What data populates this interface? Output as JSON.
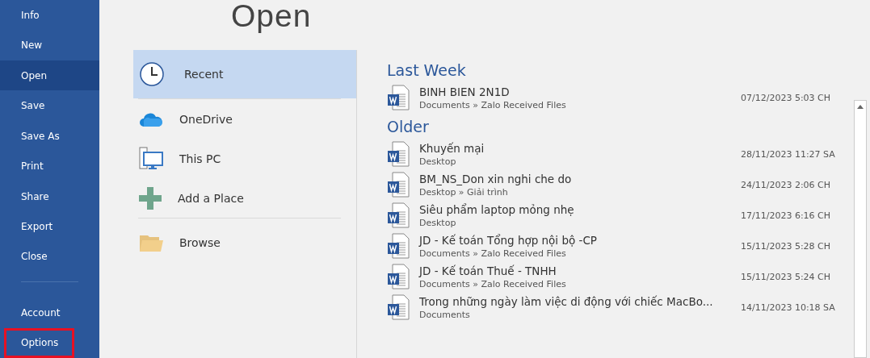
{
  "nav": {
    "items": [
      {
        "label": "Info",
        "selected": false,
        "highlighted": false
      },
      {
        "label": "New",
        "selected": false,
        "highlighted": false
      },
      {
        "label": "Open",
        "selected": true,
        "highlighted": false
      },
      {
        "label": "Save",
        "selected": false,
        "highlighted": false
      },
      {
        "label": "Save As",
        "selected": false,
        "highlighted": false
      },
      {
        "label": "Print",
        "selected": false,
        "highlighted": false
      },
      {
        "label": "Share",
        "selected": false,
        "highlighted": false
      },
      {
        "label": "Export",
        "selected": false,
        "highlighted": false
      },
      {
        "label": "Close",
        "selected": false,
        "highlighted": false
      }
    ],
    "bottom_items": [
      {
        "label": "Account",
        "selected": false,
        "highlighted": false
      },
      {
        "label": "Options",
        "selected": false,
        "highlighted": true
      }
    ]
  },
  "title": "Open",
  "places": [
    {
      "label": "Recent",
      "kind": "recent",
      "selected": true
    },
    {
      "label": "OneDrive",
      "kind": "cloud",
      "selected": false
    },
    {
      "label": "This PC",
      "kind": "pc",
      "selected": false
    },
    {
      "label": "Add a Place",
      "kind": "add",
      "selected": false
    },
    {
      "label": "Browse",
      "kind": "folder",
      "selected": false
    }
  ],
  "groups": [
    {
      "heading": "Last Week",
      "files": [
        {
          "name": "BINH BIEN 2N1D",
          "path": "Documents » Zalo Received Files",
          "date": "07/12/2023 5:03 CH"
        }
      ]
    },
    {
      "heading": "Older",
      "files": [
        {
          "name": "Khuyến mại",
          "path": "Desktop",
          "date": "28/11/2023 11:27 SA"
        },
        {
          "name": "BM_NS_Don xin nghi che do",
          "path": "Desktop » Giải trình",
          "date": "24/11/2023 2:06 CH"
        },
        {
          "name": "Siêu phẩm laptop mỏng nhẹ",
          "path": "Desktop",
          "date": "17/11/2023 6:16 CH"
        },
        {
          "name": "JD - Kế toán Tổng hợp nội bộ -CP",
          "path": "Documents » Zalo Received Files",
          "date": "15/11/2023 5:28 CH"
        },
        {
          "name": "JD - Kế toán Thuế - TNHH",
          "path": "Documents » Zalo Received Files",
          "date": "15/11/2023 5:24 CH"
        },
        {
          "name": "Trong những ngày làm việc di động với chiếc MacBo...",
          "path": "Documents",
          "date": "14/11/2023 10:18 SA"
        }
      ]
    }
  ]
}
